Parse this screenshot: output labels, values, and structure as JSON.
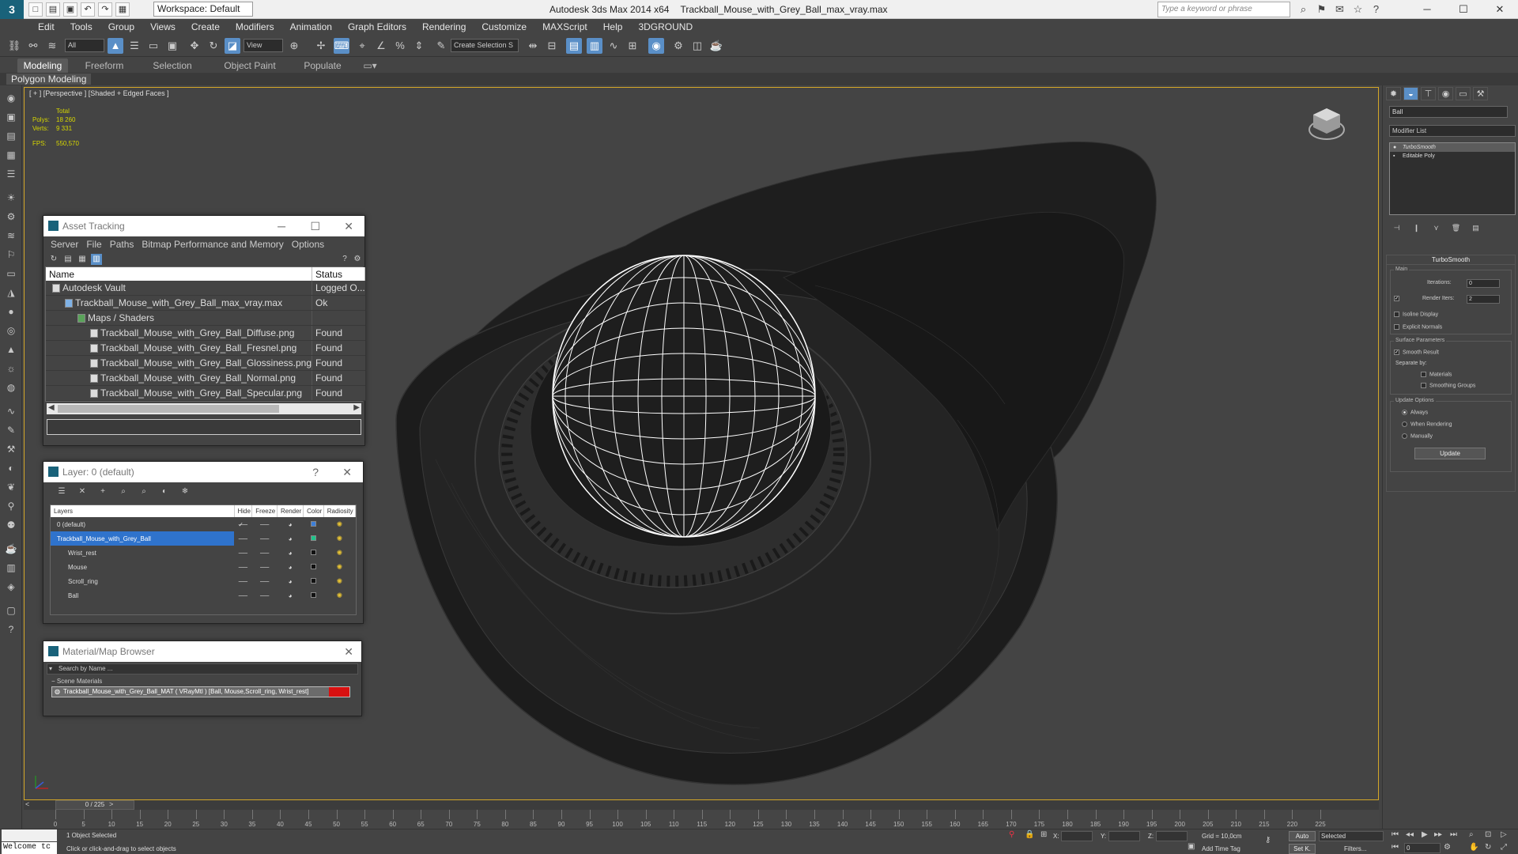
{
  "app": {
    "title": "Autodesk 3ds Max  2014 x64",
    "filename": "Trackball_Mouse_with_Grey_Ball_max_vray.max",
    "workspace": "Workspace: Default",
    "search_placeholder": "Type a keyword or phrase",
    "logo_letter": "3"
  },
  "menu": [
    "Edit",
    "Tools",
    "Group",
    "Views",
    "Create",
    "Modifiers",
    "Animation",
    "Graph Editors",
    "Rendering",
    "Customize",
    "MAXScript",
    "Help",
    "3DGROUND"
  ],
  "toolbar": {
    "selection_filter": "All",
    "ref_coord": "View",
    "named_selection": "Create Selection S"
  },
  "ribbon": {
    "tabs": [
      "Modeling",
      "Freeform",
      "Selection",
      "Object Paint",
      "Populate"
    ],
    "active_tab": "Modeling",
    "panel_label": "Polygon Modeling"
  },
  "viewport": {
    "label": "[ + ] [Perspective ] [Shaded + Edged Faces ]",
    "stats": {
      "total_label": "Total",
      "polys_label": "Polys:",
      "polys_value": "18 260",
      "verts_label": "Verts:",
      "verts_value": "9 331",
      "fps_label": "FPS:",
      "fps_value": "550,570"
    },
    "colors": {
      "border": "#d4a728",
      "stats": "#d6d600",
      "background": "#444444",
      "model": "#1f1f1f",
      "wire": "#ffffff"
    }
  },
  "asset_tracking": {
    "title": "Asset Tracking",
    "menu": [
      "Server",
      "File",
      "Paths",
      "Bitmap Performance and Memory",
      "Options"
    ],
    "columns": [
      "Name",
      "Status"
    ],
    "rows": [
      {
        "name": "Autodesk Vault",
        "status": "Logged O...",
        "indent": 0,
        "icon": "vault"
      },
      {
        "name": "Trackball_Mouse_with_Grey_Ball_max_vray.max",
        "status": "Ok",
        "indent": 1,
        "icon": "file"
      },
      {
        "name": "Maps / Shaders",
        "status": "",
        "indent": 2,
        "icon": "folder"
      },
      {
        "name": "Trackball_Mouse_with_Grey_Ball_Diffuse.png",
        "status": "Found",
        "indent": 3,
        "icon": "image"
      },
      {
        "name": "Trackball_Mouse_with_Grey_Ball_Fresnel.png",
        "status": "Found",
        "indent": 3,
        "icon": "image"
      },
      {
        "name": "Trackball_Mouse_with_Grey_Ball_Glossiness.png",
        "status": "Found",
        "indent": 3,
        "icon": "image"
      },
      {
        "name": "Trackball_Mouse_with_Grey_Ball_Normal.png",
        "status": "Found",
        "indent": 3,
        "icon": "image"
      },
      {
        "name": "Trackball_Mouse_with_Grey_Ball_Specular.png",
        "status": "Found",
        "indent": 3,
        "icon": "image"
      }
    ]
  },
  "layer_dialog": {
    "title": "Layer: 0 (default)",
    "help": "?",
    "columns": [
      "Layers",
      "Hide",
      "Freeze",
      "Render",
      "Color",
      "Radiosity"
    ],
    "rows": [
      {
        "name": "0 (default)",
        "active": true,
        "color": "#3d7fd8"
      },
      {
        "name": "Trackball_Mouse_with_Grey_Ball",
        "selected": true,
        "color": "#1fc48a"
      },
      {
        "name": "Wrist_rest",
        "color": "#111111"
      },
      {
        "name": "Mouse",
        "color": "#111111"
      },
      {
        "name": "Scroll_ring",
        "color": "#111111"
      },
      {
        "name": "Ball",
        "color": "#111111"
      }
    ]
  },
  "material_browser": {
    "title": "Material/Map Browser",
    "search_placeholder": "Search by Name ...",
    "section": "Scene Materials",
    "item": "Trackball_Mouse_with_Grey_Ball_MAT ( VRayMtl ) [Ball, Mouse,Scroll_ring, Wrist_rest]",
    "swatch_color": "#d91010"
  },
  "command_panel": {
    "object_name": "Ball",
    "modifier_list": "Modifier List",
    "stack": [
      "TurboSmooth",
      "Editable Poly"
    ],
    "rollout_title": "TurboSmooth",
    "main_label": "Main",
    "iterations_label": "Iterations:",
    "iterations_value": "0",
    "render_iters_label": "Render Iters:",
    "render_iters_value": "2",
    "isoline": "Isoline Display",
    "explicit_normals": "Explicit Normals",
    "surface_params": "Surface Parameters",
    "smooth_result": "Smooth Result",
    "separate_by": "Separate by:",
    "materials": "Materials",
    "smoothing_groups": "Smoothing Groups",
    "update_options": "Update Options",
    "always": "Always",
    "when_rendering": "When Rendering",
    "manually": "Manually",
    "update_button": "Update"
  },
  "timeline": {
    "frame": "0 / 225",
    "ticks": [
      "0",
      "5",
      "10",
      "15",
      "20",
      "25",
      "30",
      "35",
      "40",
      "45",
      "50",
      "55",
      "60",
      "65",
      "70",
      "75",
      "80",
      "85",
      "90",
      "95",
      "100",
      "105",
      "110",
      "115",
      "120",
      "125",
      "130",
      "135",
      "140",
      "145",
      "150",
      "155",
      "160",
      "165",
      "170",
      "175",
      "180",
      "185",
      "190",
      "195",
      "200",
      "205",
      "210",
      "215",
      "220",
      "225"
    ]
  },
  "status": {
    "maxscript": "Welcome tc",
    "selection": "1 Object Selected",
    "prompt": "Click or click-and-drag to select objects",
    "x_label": "X:",
    "y_label": "Y:",
    "z_label": "Z:",
    "grid": "Grid = 10,0cm",
    "add_time_tag": "Add Time Tag",
    "auto": "Auto",
    "set_key": "Set K.",
    "selected": "Selected",
    "filters": "Filters...",
    "frame_field": "0"
  }
}
